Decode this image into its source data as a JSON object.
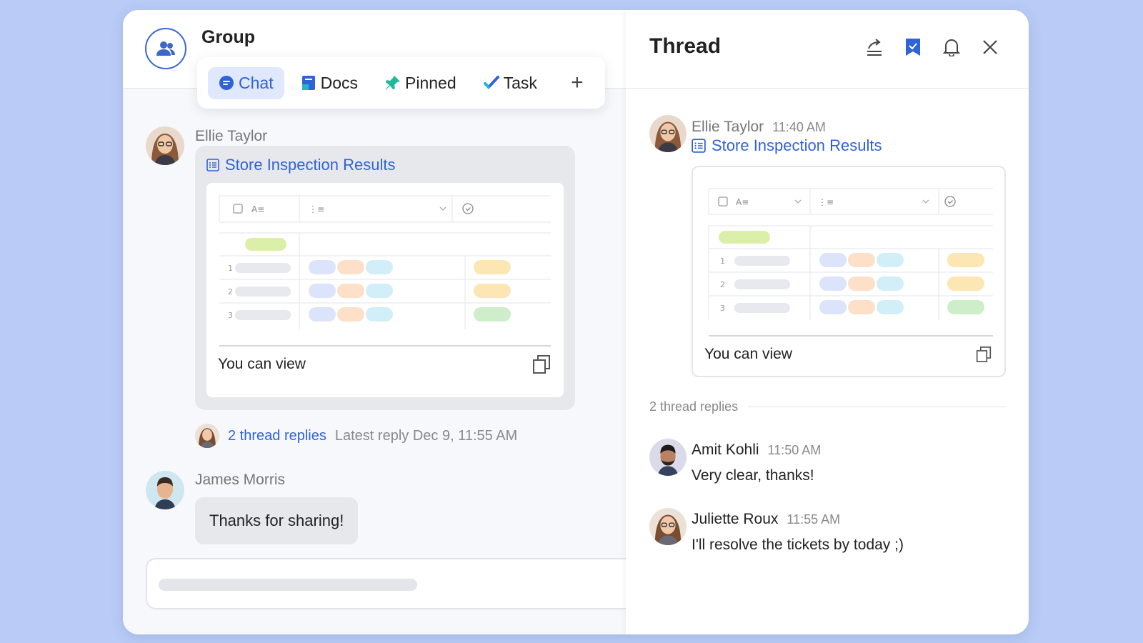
{
  "group": {
    "title": "Group",
    "tabs": [
      {
        "label": "Chat",
        "icon": "chat-bubble-icon"
      },
      {
        "label": "Docs",
        "icon": "docs-icon"
      },
      {
        "label": "Pinned",
        "icon": "pin-icon"
      },
      {
        "label": "Task",
        "icon": "checkmark-icon"
      }
    ],
    "add_tab": "+"
  },
  "chat": {
    "messages": [
      {
        "sender": "Ellie Taylor",
        "doc_title": "Store Inspection Results",
        "permission": "You can view"
      },
      {
        "sender": "James Morris",
        "text": "Thanks for sharing!"
      }
    ],
    "thread_summary": {
      "link": "2 thread replies",
      "meta": "Latest reply Dec 9, 11:55 AM"
    }
  },
  "thread": {
    "title": "Thread",
    "original": {
      "sender": "Ellie Taylor",
      "time": "11:40 AM",
      "doc_title": "Store Inspection Results",
      "permission": "You can view"
    },
    "replies_label": "2 thread replies",
    "replies": [
      {
        "sender": "Amit Kohli",
        "time": "11:50 AM",
        "text": "Very clear, thanks!"
      },
      {
        "sender": "Juliette Roux",
        "time": "11:55 AM",
        "text": "I'll resolve the tickets by today ;)"
      }
    ]
  },
  "doc_preview": {
    "rows": [
      "1",
      "2",
      "3"
    ],
    "status_colors": [
      "#fbe6b4",
      "#fbe6b4",
      "#cdeec8"
    ],
    "header_tag_color": "#dcefa9",
    "tag_colors": [
      "#dbe4fb",
      "#fde0c7",
      "#d2eef8"
    ]
  },
  "colors": {
    "accent": "#2f63d7",
    "background": "#b9cbf6"
  }
}
